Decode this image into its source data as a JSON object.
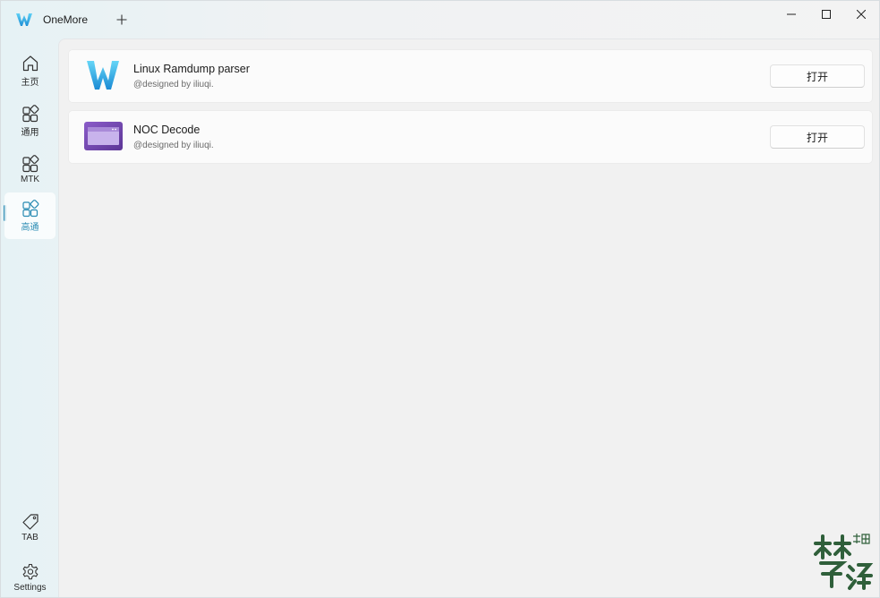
{
  "app": {
    "title": "OneMore"
  },
  "window_controls": [
    "minimize",
    "maximize",
    "close"
  ],
  "sidebar": {
    "items": [
      {
        "id": "home",
        "label": "主页",
        "icon": "home-icon"
      },
      {
        "id": "general",
        "label": "通用",
        "icon": "apps-icon"
      },
      {
        "id": "mtk",
        "label": "MTK",
        "icon": "apps-icon"
      },
      {
        "id": "qualcomm",
        "label": "高通",
        "icon": "apps-icon",
        "active": true
      }
    ],
    "footer": [
      {
        "id": "tab",
        "label": "TAB",
        "icon": "tag-icon"
      },
      {
        "id": "settings",
        "label": "Settings",
        "icon": "gear-icon"
      }
    ]
  },
  "tools": [
    {
      "title": "Linux Ramdump parser",
      "subtitle": "@designed by iliuqi.",
      "icon": "w-logo-icon",
      "button": "打开"
    },
    {
      "title": "NOC Decode",
      "subtitle": "@designed by iliuqi.",
      "icon": "purple-window-icon",
      "button": "打开"
    }
  ],
  "colors": {
    "accent": "#2a8bb3",
    "logo_blue": "#29a8e0",
    "purple": "#7a4fb8"
  }
}
